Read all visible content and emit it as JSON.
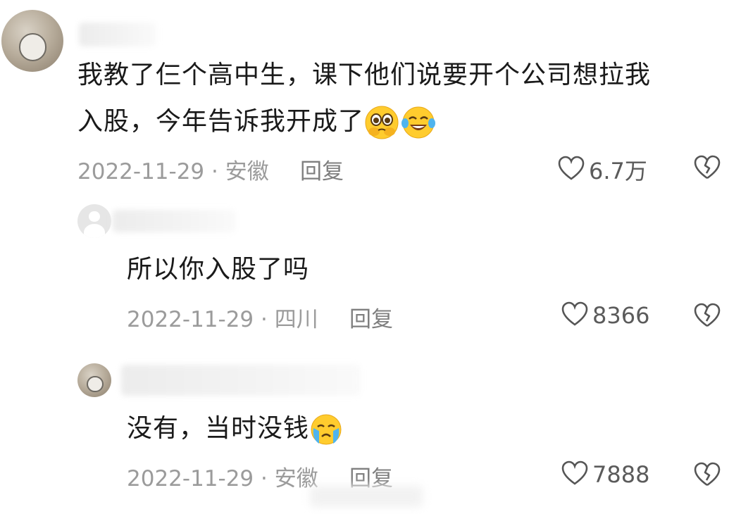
{
  "comments": [
    {
      "text_line1": "我教了仨个高中生，课下他们说要开个公司想拉我",
      "text_line2": "入股，今年告诉我开成了",
      "emojis": [
        "pleading-face-icon",
        "tears-of-joy-icon"
      ],
      "date": "2022-11-29",
      "separator": "·",
      "location": "安徽",
      "reply_label": "回复",
      "likes": "6.7万"
    },
    {
      "text": "所以你入股了吗",
      "date": "2022-11-29",
      "separator": "·",
      "location": "四川",
      "reply_label": "回复",
      "likes": "8366"
    },
    {
      "text": "没有，当时没钱",
      "emojis": [
        "crying-face-icon"
      ],
      "date": "2022-11-29",
      "separator": "·",
      "location": "安徽",
      "reply_label": "回复",
      "likes": "7888"
    }
  ],
  "colors": {
    "text": "#1a1a1a",
    "meta": "#9b9b9b",
    "icon": "#555555",
    "emoji_yellow": "#ffcc2e"
  }
}
